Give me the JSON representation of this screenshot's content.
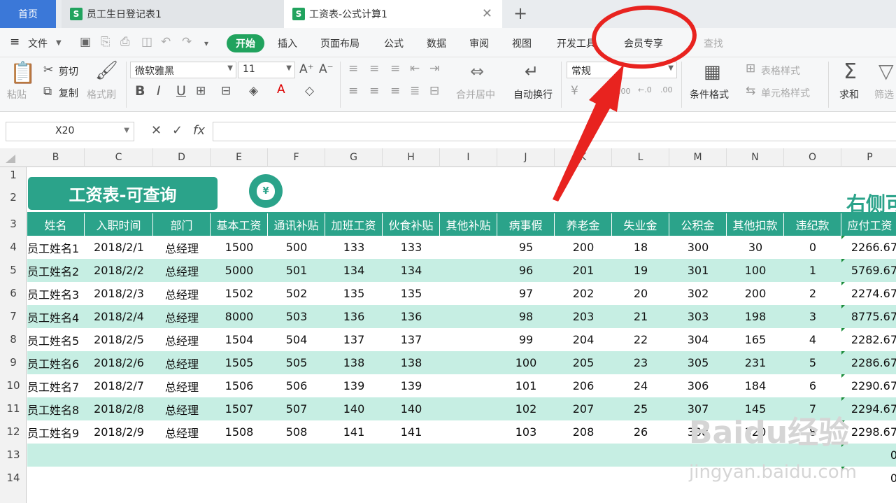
{
  "tabs": {
    "home": "首页",
    "doc1": "员工生日登记表1",
    "doc2": "工资表-公式计算1",
    "s_icon": "S"
  },
  "menu": {
    "file": "文件",
    "start": "开始",
    "items": [
      "插入",
      "页面布局",
      "公式",
      "数据",
      "审阅",
      "视图",
      "开发工具",
      "会员专享"
    ],
    "search": "查找"
  },
  "ribbon": {
    "paste": "粘贴",
    "cut": "剪切",
    "copy": "复制",
    "format_painter": "格式刷",
    "font_name": "微软雅黑",
    "font_size": "11",
    "merge": "合并居中",
    "wrap": "自动换行",
    "number_format": "常规",
    "conditional": "条件格式",
    "table_style": "表格样式",
    "cell_style": "单元格样式",
    "sum": "求和",
    "filter": "筛选"
  },
  "formula_bar": {
    "cell_ref": "X20",
    "value": ""
  },
  "columns": [
    "B",
    "C",
    "D",
    "E",
    "F",
    "G",
    "H",
    "I",
    "J",
    "K",
    "L",
    "M",
    "N",
    "O",
    "P"
  ],
  "rows": [
    "1",
    "2",
    "3",
    "4",
    "5",
    "6",
    "7",
    "8",
    "9",
    "10",
    "11",
    "12",
    "13",
    "14"
  ],
  "sheet": {
    "title": "工资表-可查询",
    "money_symbol": "¥",
    "right_title": "右侧可",
    "headers": [
      "姓名",
      "入职时间",
      "部门",
      "基本工资",
      "通讯补贴",
      "加班工资",
      "伙食补贴",
      "其他补贴",
      "病事假",
      "养老金",
      "失业金",
      "公积金",
      "其他扣款",
      "违纪款",
      "应付工资"
    ],
    "data": [
      [
        "员工姓名1",
        "2018/2/1",
        "总经理",
        "1500",
        "500",
        "133",
        "133",
        "",
        "95",
        "200",
        "18",
        "300",
        "30",
        "0",
        "2266.67"
      ],
      [
        "员工姓名2",
        "2018/2/2",
        "总经理",
        "5000",
        "501",
        "134",
        "134",
        "",
        "96",
        "201",
        "19",
        "301",
        "100",
        "1",
        "5769.67"
      ],
      [
        "员工姓名3",
        "2018/2/3",
        "总经理",
        "1502",
        "502",
        "135",
        "135",
        "",
        "97",
        "202",
        "20",
        "302",
        "200",
        "2",
        "2274.67"
      ],
      [
        "员工姓名4",
        "2018/2/4",
        "总经理",
        "8000",
        "503",
        "136",
        "136",
        "",
        "98",
        "203",
        "21",
        "303",
        "198",
        "3",
        "8775.67"
      ],
      [
        "员工姓名5",
        "2018/2/5",
        "总经理",
        "1504",
        "504",
        "137",
        "137",
        "",
        "99",
        "204",
        "22",
        "304",
        "165",
        "4",
        "2282.67"
      ],
      [
        "员工姓名6",
        "2018/2/6",
        "总经理",
        "1505",
        "505",
        "138",
        "138",
        "",
        "100",
        "205",
        "23",
        "305",
        "231",
        "5",
        "2286.67"
      ],
      [
        "员工姓名7",
        "2018/2/7",
        "总经理",
        "1506",
        "506",
        "139",
        "139",
        "",
        "101",
        "206",
        "24",
        "306",
        "184",
        "6",
        "2290.67"
      ],
      [
        "员工姓名8",
        "2018/2/8",
        "总经理",
        "1507",
        "507",
        "140",
        "140",
        "",
        "102",
        "207",
        "25",
        "307",
        "145",
        "7",
        "2294.67"
      ],
      [
        "员工姓名9",
        "2018/2/9",
        "总经理",
        "1508",
        "508",
        "141",
        "141",
        "",
        "103",
        "208",
        "26",
        "308",
        "320",
        "8",
        "2298.67"
      ]
    ],
    "empty_rows": [
      [
        "",
        "",
        "",
        "",
        "",
        "",
        "",
        "",
        "",
        "",
        "",
        "",
        "",
        "",
        "0"
      ],
      [
        "",
        "",
        "",
        "",
        "",
        "",
        "",
        "",
        "",
        "",
        "",
        "",
        "",
        "",
        "0"
      ]
    ]
  },
  "watermark": {
    "line1": "Baidu经验",
    "line2": "jingyan.baidu.com"
  },
  "colors": {
    "teal": "#2ba38a",
    "band": "#c6eee3",
    "accent_green": "#21a35e",
    "annotation_red": "#e8231f"
  }
}
